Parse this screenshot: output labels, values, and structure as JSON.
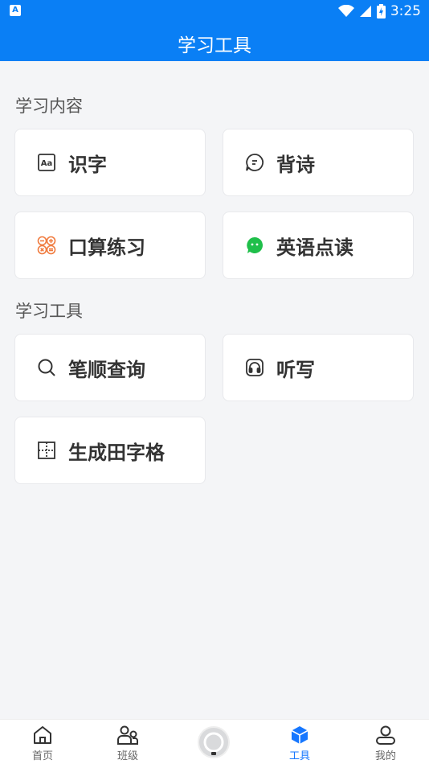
{
  "status_bar": {
    "time": "3:25",
    "app_icon": "A"
  },
  "header": {
    "title": "学习工具"
  },
  "sections": [
    {
      "title": "学习内容",
      "items": [
        {
          "label": "识字",
          "icon": "font-box-icon"
        },
        {
          "label": "背诗",
          "icon": "chat-bubble-icon"
        },
        {
          "label": "口算练习",
          "icon": "calculator-icon",
          "icon_color": "#f07b3f"
        },
        {
          "label": "英语点读",
          "icon": "wechat-bubble-icon",
          "icon_color": "#1fbf4a"
        }
      ]
    },
    {
      "title": "学习工具",
      "items": [
        {
          "label": "笔顺查询",
          "icon": "search-icon"
        },
        {
          "label": "听写",
          "icon": "headphones-icon"
        },
        {
          "label": "生成田字格",
          "icon": "grid-icon"
        }
      ]
    }
  ],
  "tab_bar": {
    "tabs": [
      {
        "label": "首页",
        "icon": "home-icon"
      },
      {
        "label": "班级",
        "icon": "class-icon"
      },
      {
        "label": "",
        "icon": "center-circle-icon"
      },
      {
        "label": "工具",
        "icon": "cube-icon",
        "active": true
      },
      {
        "label": "我的",
        "icon": "user-icon"
      }
    ]
  },
  "colors": {
    "brand": "#0a7ff5",
    "active_tab": "#1677ff",
    "background": "#f4f5f7"
  }
}
